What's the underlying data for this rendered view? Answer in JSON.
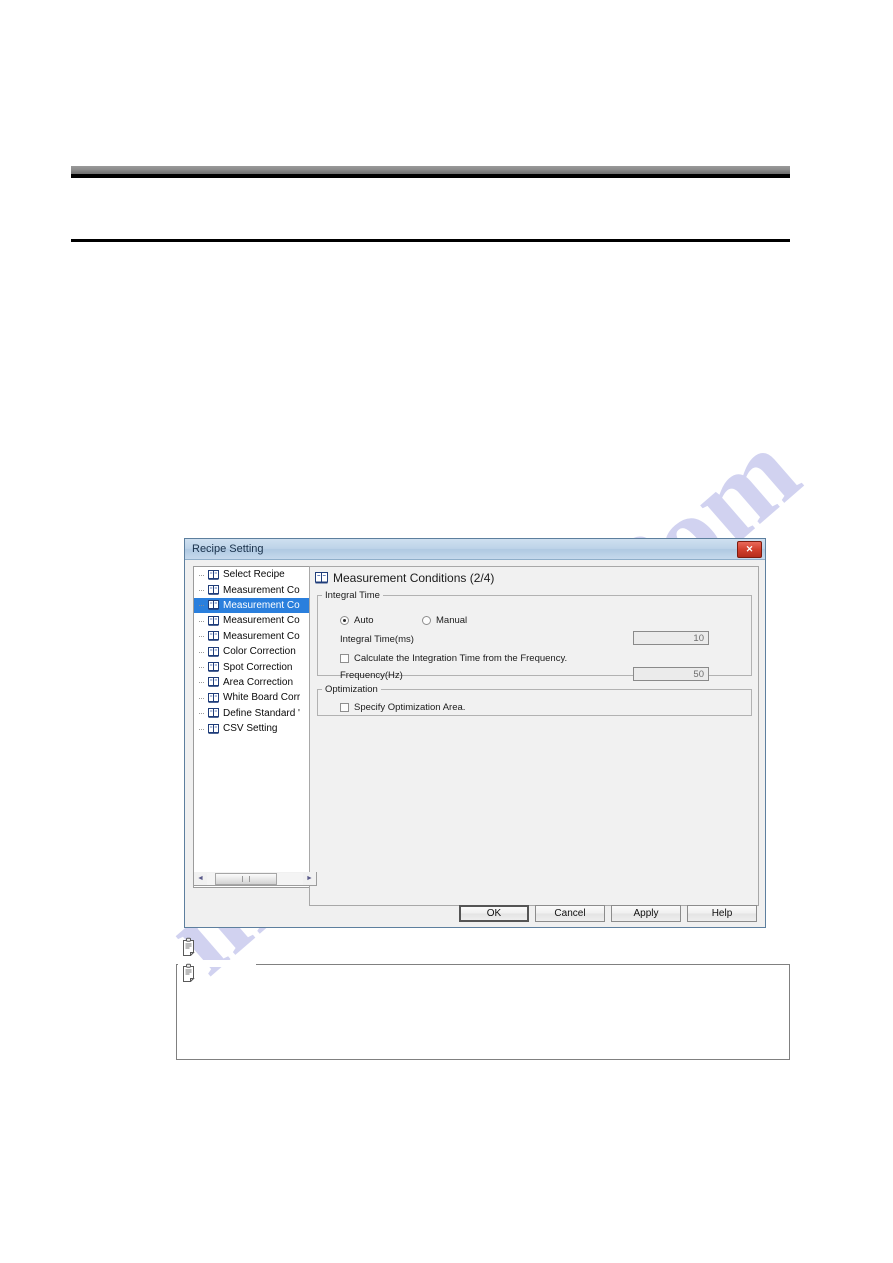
{
  "page": {
    "watermark_left": "manualshive",
    "watermark_right": ".com"
  },
  "dialog": {
    "title": "Recipe Setting",
    "close_label": "✕",
    "tree": {
      "items": [
        {
          "label": "Select Recipe",
          "selected": false
        },
        {
          "label": "Measurement Co",
          "selected": false
        },
        {
          "label": "Measurement Co",
          "selected": true
        },
        {
          "label": "Measurement Co",
          "selected": false
        },
        {
          "label": "Measurement Co",
          "selected": false
        },
        {
          "label": "Color Correction",
          "selected": false
        },
        {
          "label": "Spot Correction",
          "selected": false
        },
        {
          "label": "Area Correction",
          "selected": false
        },
        {
          "label": "White Board Corr",
          "selected": false
        },
        {
          "label": "Define Standard '",
          "selected": false
        },
        {
          "label": "CSV Setting",
          "selected": false
        }
      ],
      "scroll_left_arrow": "◄",
      "scroll_right_arrow": "►"
    },
    "content": {
      "heading": "Measurement Conditions (2/4)",
      "integral_group": {
        "legend": "Integral Time",
        "radio_auto": "Auto",
        "radio_manual": "Manual",
        "auto_selected": true,
        "integral_time_label": "Integral Time(ms)",
        "integral_time_value": "10",
        "calculate_checkbox_label": "Calculate the Integration Time from the Frequency.",
        "frequency_label": "Frequency(Hz)",
        "frequency_value": "50"
      },
      "optimization_group": {
        "legend": "Optimization",
        "specify_checkbox_label": "Specify Optimization Area."
      }
    },
    "buttons": {
      "ok": "OK",
      "cancel": "Cancel",
      "apply": "Apply",
      "help": "Help"
    }
  },
  "note": {
    "text": ""
  }
}
